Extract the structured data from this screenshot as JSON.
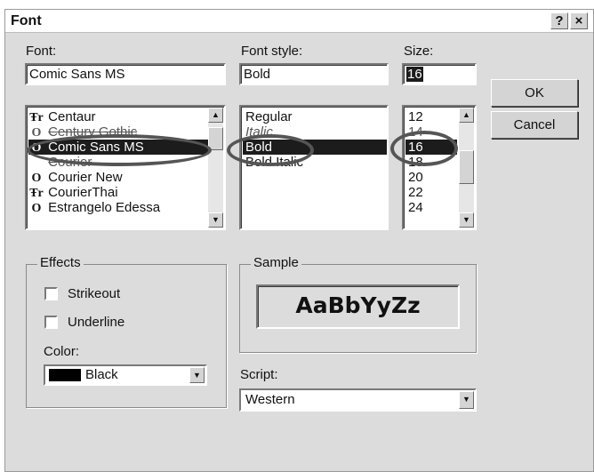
{
  "window": {
    "title": "Font",
    "help_button": "?",
    "close_button": "×"
  },
  "font": {
    "label": "Font:",
    "value": "Comic Sans MS",
    "items": [
      {
        "icon": "Ŧr",
        "name": "Centaur"
      },
      {
        "icon": "O",
        "name": "Century Gothic"
      },
      {
        "icon": "O",
        "name": "Comic Sans MS"
      },
      {
        "icon": "",
        "name": "Courier"
      },
      {
        "icon": "O",
        "name": "Courier New"
      },
      {
        "icon": "Ŧr",
        "name": "CourierThai"
      },
      {
        "icon": "O",
        "name": "Estrangelo Edessa"
      }
    ]
  },
  "font_style": {
    "label": "Font style:",
    "value": "Bold",
    "items": [
      "Regular",
      "Italic",
      "Bold",
      "Bold Italic"
    ]
  },
  "size": {
    "label": "Size:",
    "value": "16",
    "items": [
      "12",
      "14",
      "16",
      "18",
      "20",
      "22",
      "24"
    ]
  },
  "buttons": {
    "ok": "OK",
    "cancel": "Cancel"
  },
  "effects": {
    "label": "Effects",
    "strikeout": "Strikeout",
    "underline": "Underline",
    "color_label": "Color:",
    "color_value": "Black",
    "color_swatch": "#000000"
  },
  "sample": {
    "label": "Sample",
    "text": "AaBbYyZz"
  },
  "script": {
    "label": "Script:",
    "value": "Western"
  }
}
